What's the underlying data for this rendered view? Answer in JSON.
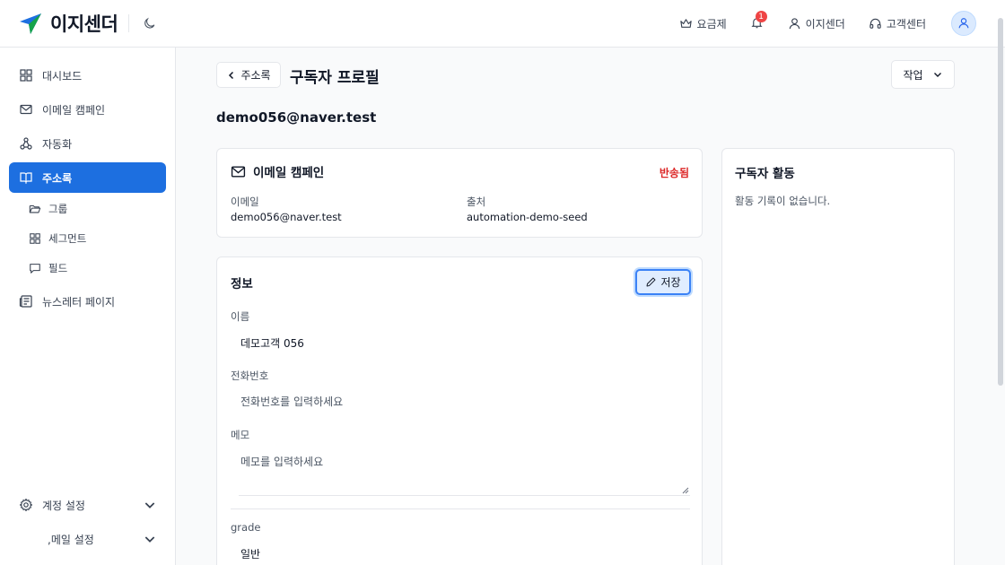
{
  "header": {
    "logo_text": "이지센더",
    "pricing": "요금제",
    "notification_count": "1",
    "account": "이지센더",
    "support": "고객센터"
  },
  "sidebar": {
    "items": [
      {
        "label": "대시보드"
      },
      {
        "label": "이메일 캠페인"
      },
      {
        "label": "자동화"
      },
      {
        "label": "주소록"
      },
      {
        "label": "뉴스레터 페이지"
      }
    ],
    "sub_items": [
      {
        "label": "그룹"
      },
      {
        "label": "세그먼트"
      },
      {
        "label": "필드"
      }
    ],
    "bottom": [
      {
        "label": "계정 설정"
      },
      {
        "label": ",메일 설정"
      }
    ]
  },
  "page": {
    "back_label": "주소록",
    "title": "구독자 프로필",
    "action_label": "작업",
    "email": "demo056@naver.test"
  },
  "campaign_card": {
    "title": "이메일 캠페인",
    "status": "반송됨",
    "email_label": "이메일",
    "email_value": "demo056@naver.test",
    "source_label": "출처",
    "source_value": "automation-demo-seed"
  },
  "info_card": {
    "title": "정보",
    "save_label": "저장",
    "name_label": "이름",
    "name_value": "데모고객 056",
    "phone_label": "전화번호",
    "phone_placeholder": "전화번호를 입력하세요",
    "memo_label": "메모",
    "memo_placeholder": "메모를 입력하세요",
    "grade_label": "grade",
    "grade_value": "일반"
  },
  "activity_card": {
    "title": "구독자 활동",
    "empty_text": "활동 기록이 없습니다."
  },
  "colors": {
    "accent": "#1d6fe0",
    "danger": "#dc2626"
  }
}
